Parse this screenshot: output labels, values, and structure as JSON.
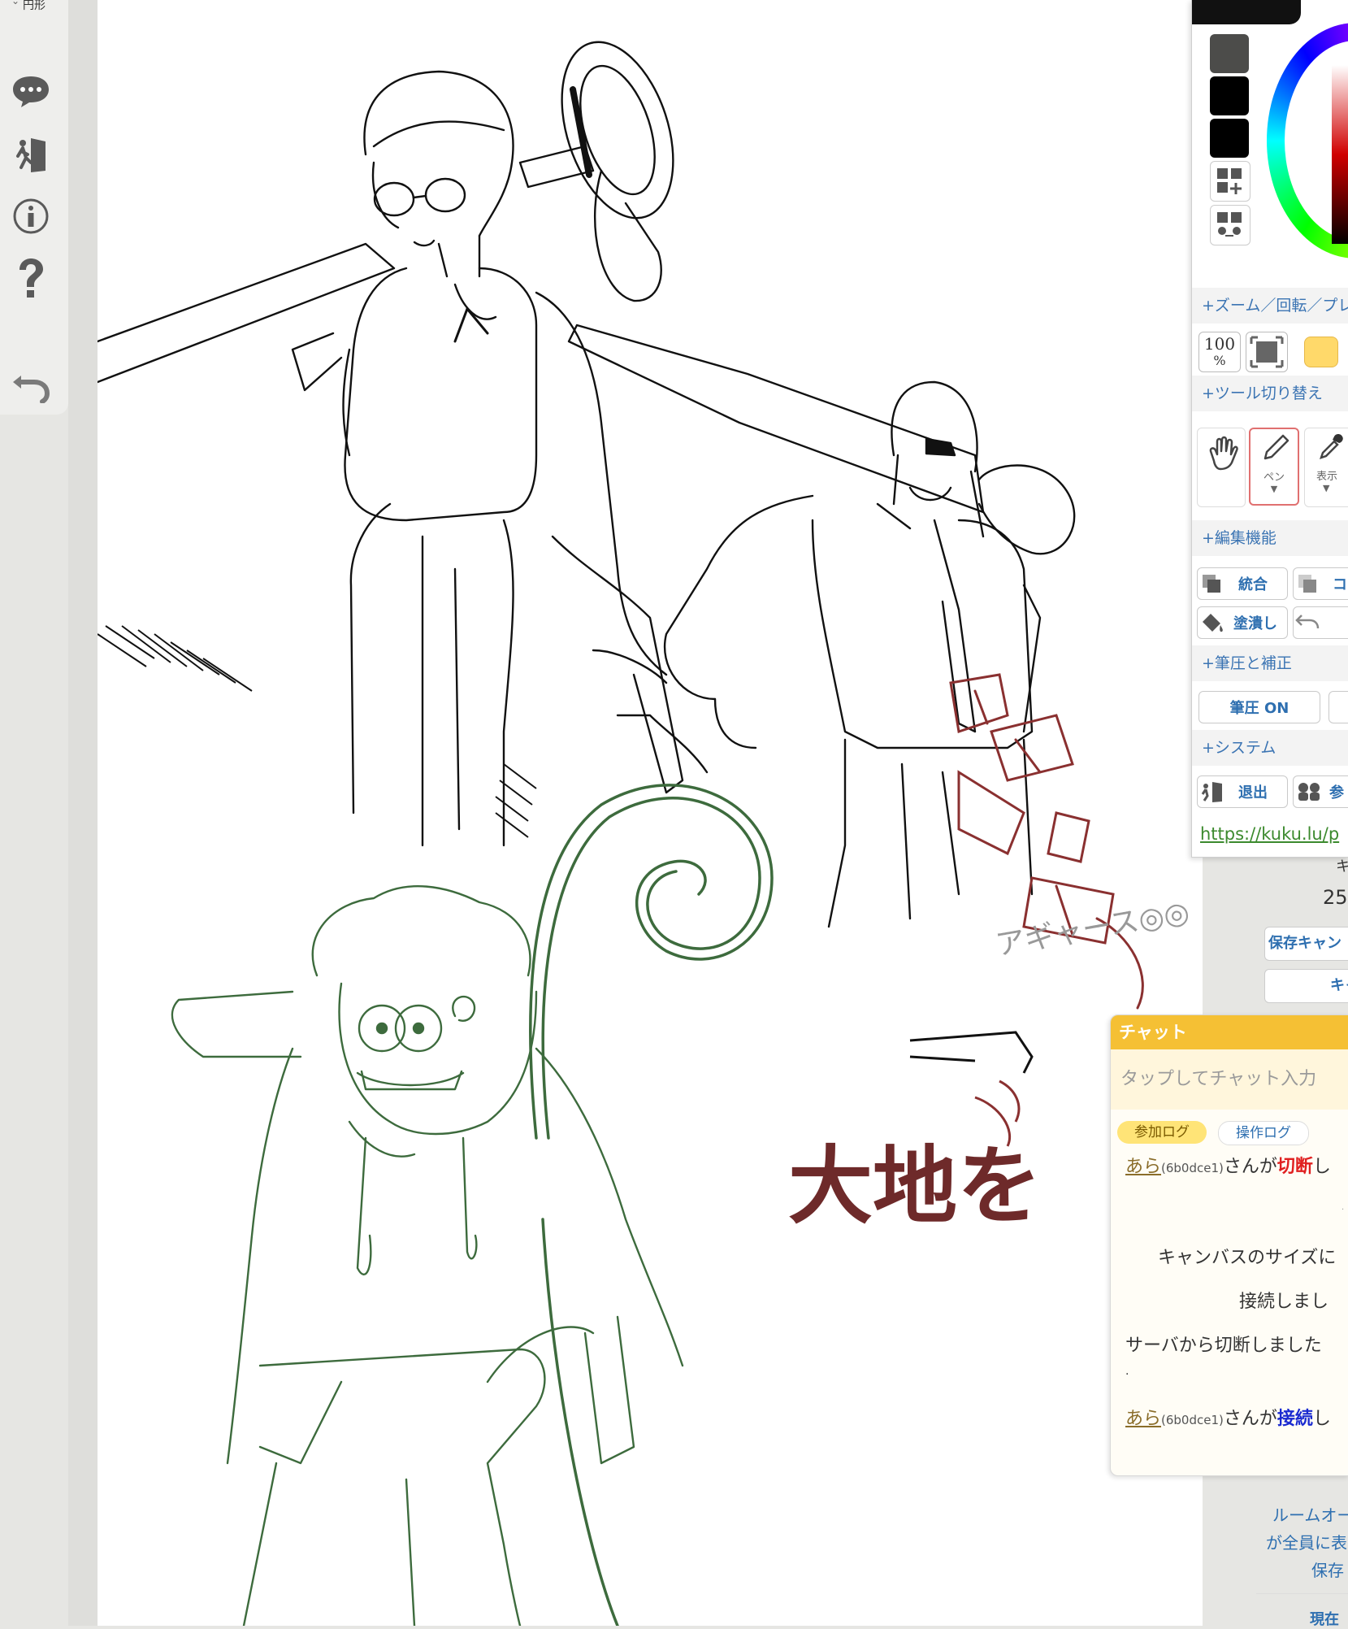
{
  "left_toolbar": {
    "shape_label": "円形",
    "icons": [
      "chat-bubble-icon",
      "exit-door-icon",
      "info-icon",
      "help-icon",
      "undo-icon"
    ]
  },
  "canvas": {
    "texts": {
      "agyas": "アギャース◎◎",
      "daichi": "大地を"
    }
  },
  "right_panel": {
    "colors": {
      "swatch_1": "#4c4c4a",
      "swatch_2": "#000000",
      "swatch_3": "#000000",
      "accent_yellow": "#ffd96a"
    },
    "sections": {
      "zoom": "+ズーム／回転／プレ",
      "tools": "+ツール切り替え",
      "edit": "+編集機能",
      "pressure": "+筆圧と補正",
      "system": "+システム"
    },
    "zoom_value": "100",
    "zoom_unit": "%",
    "tools": {
      "pen_label": "ペン",
      "view_label": "表示"
    },
    "edit_buttons": {
      "merge": "統合",
      "copy": "コ",
      "fill": "塗潰し"
    },
    "pressure_button": "筆圧 ON",
    "system_buttons": {
      "exit": "退出",
      "join": "参"
    },
    "url": "https://kuku.lu/p"
  },
  "behind_panel": {
    "kya": "キ",
    "value_25": "25",
    "save_cancel": "保存キャン",
    "kya2": "キャ",
    "room_owner": "ルームオー",
    "all_members": "が全員に表",
    "save": "保存",
    "current": "現在"
  },
  "chat": {
    "title": "チャット",
    "input_placeholder": "タップしてチャット入力",
    "tabs": {
      "join_log": "参加ログ",
      "operation_log": "操作ログ"
    },
    "messages": {
      "m1_user": "あら",
      "m1_id": "(6b0dce1)",
      "m1_text": "さんが",
      "m1_action": "切断",
      "m1_tail": "し",
      "m2_text": "キャンバスのサイズに",
      "m3_text": "接続しまし",
      "m4_text": "サーバから切断しました",
      "m5_text": ".",
      "m6_user": "あら",
      "m6_id": "(6b0dce1)",
      "m6_text": "さんが",
      "m6_action": "接続",
      "m6_tail": "し"
    }
  }
}
